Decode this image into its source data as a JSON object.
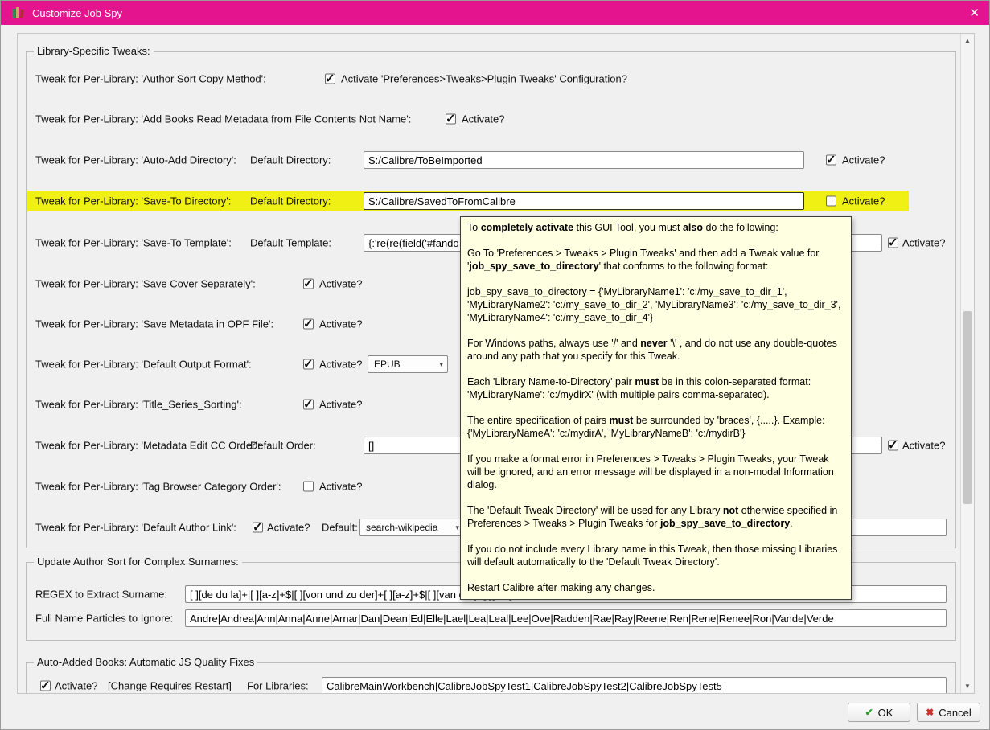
{
  "window": {
    "title": "Customize Job Spy",
    "close_icon": "✕"
  },
  "icons": {
    "up_arrow": "▲",
    "down_arrow": "▼",
    "combo_arrow": "▾"
  },
  "groups": {
    "library": "Library-Specific Tweaks:",
    "author_sort": "Update Author Sort for Complex Surnames:",
    "auto_added": "Auto-Added Books: Automatic JS Quality Fixes"
  },
  "rows": [
    {
      "label": "Tweak for Per-Library: 'Author Sort Copy Method':",
      "activate_label": "Activate 'Preferences>Tweaks>Plugin Tweaks' Configuration?",
      "activate_checked": true
    },
    {
      "label": "Tweak for Per-Library: 'Add Books Read Metadata from File Contents Not Name':",
      "activate_label": "Activate?",
      "activate_checked": true
    },
    {
      "label": "Tweak for Per-Library: 'Auto-Add Directory':",
      "field_label": "Default Directory:",
      "value": "S:/Calibre/ToBeImported",
      "activate_label": "Activate?",
      "activate_checked": true
    },
    {
      "label": "Tweak for Per-Library: 'Save-To Directory':",
      "field_label": "Default Directory:",
      "value": "S:/Calibre/SavedToFromCalibre",
      "activate_label": "Activate?",
      "activate_checked": false,
      "highlighted": true
    },
    {
      "label": "Tweak for Per-Library: 'Save-To Template':",
      "field_label": "Default Template:",
      "value": "{:'re(re(field('#fando",
      "activate_label": "Activate?",
      "activate_checked": true
    },
    {
      "label": "Tweak for Per-Library: 'Save Cover Separately':",
      "activate_label": "Activate?",
      "activate_checked": true
    },
    {
      "label": "Tweak for Per-Library: 'Save Metadata in OPF File':",
      "activate_label": "Activate?",
      "activate_checked": true
    },
    {
      "label": "Tweak for Per-Library: 'Default Output Format':",
      "activate_label": "Activate?",
      "activate_checked": true,
      "dropdown_value": "EPUB"
    },
    {
      "label": "Tweak for Per-Library: 'Title_Series_Sorting':",
      "activate_label": "Activate?",
      "activate_checked": true
    },
    {
      "label": "Tweak for Per-Library: 'Metadata Edit CC Order':",
      "field_label": "Default Order:",
      "value": "[]",
      "activate_label": "Activate?",
      "activate_checked": true
    },
    {
      "label": "Tweak for Per-Library: 'Tag Browser Category Order':",
      "activate_label": "Activate?",
      "activate_checked": false
    },
    {
      "label": "Tweak for Per-Library: 'Default Author Link':",
      "activate_label": "Activate?",
      "activate_checked": true,
      "default_label": "Default:",
      "dropdown_value": "search-wikipedia",
      "extra_value": ""
    }
  ],
  "author_sort": {
    "regex_label": "REGEX to Extract Surname:",
    "regex_value": "[ ][de du la]+|[ ][a-z]+$|[ ][von und zu der]+[ ][a-z]+$|[ ][van der]+[ ][a-z]+$",
    "particles_label": "Full Name Particles to Ignore:",
    "particles_value": "Andre|Andrea|Ann|Anna|Anne|Arnar|Dan|Dean|Ed|Elle|Lael|Lea|Leal|Lee|Ove|Radden|Rae|Ray|Reene|Ren|Rene|Renee|Ron|Vande|Verde"
  },
  "auto_added": {
    "activate_label": "Activate?",
    "restart_note": "[Change Requires Restart]",
    "for_libraries_label": "For Libraries:",
    "libraries_value": "CalibreMainWorkbench|CalibreJobSpyTest1|CalibreJobSpyTest2|CalibreJobSpyTest5",
    "activate_checked": true
  },
  "tooltip": {
    "paragraphs": [
      "To **completely activate** this GUI Tool, you must **also** do the following:",
      "Go To 'Preferences > Tweaks > Plugin Tweaks' and then add a Tweak value for '**job_spy_save_to_directory**' that conforms to the following format:",
      "job_spy_save_to_directory = {'MyLibraryName1': 'c:/my_save_to_dir_1', 'MyLibraryName2': 'c:/my_save_to_dir_2', 'MyLibraryName3': 'c:/my_save_to_dir_3', 'MyLibraryName4': 'c:/my_save_to_dir_4'}",
      "For Windows paths, always use '/' and **never** '\\' , and do not use any double-quotes around any path that you specify for this Tweak.",
      "Each 'Library Name-to-Directory' pair **must** be in this colon-separated format: 'MyLibraryName': 'c:/mydirX' (with multiple pairs comma-separated).",
      "The entire specification of pairs **must** be surrounded by 'braces', {.....}. Example: {'MyLibraryNameA': 'c:/mydirA', 'MyLibraryNameB': 'c:/mydirB'}",
      "If you make a format error in Preferences > Tweaks > Plugin Tweaks, your Tweak will be ignored, and an error message will be displayed in a non-modal Information dialog.",
      "The 'Default Tweak Directory' will be used for any Library **not** otherwise specified in Preferences > Tweaks > Plugin Tweaks for **job_spy_save_to_directory**.",
      "If you do not include every Library name in this Tweak, then those missing Libraries will default automatically to the 'Default Tweak Directory'.",
      "Restart Calibre after making any changes."
    ]
  },
  "buttons": {
    "ok": "OK",
    "ok_icon": "✔",
    "cancel": "Cancel",
    "cancel_icon": "✖"
  },
  "colors": {
    "titlebar": "#e4148e",
    "highlight": "#f0f014",
    "tooltip_bg": "#ffffe1",
    "ok_green": "#2e9e2e",
    "cancel_red": "#d03030"
  }
}
